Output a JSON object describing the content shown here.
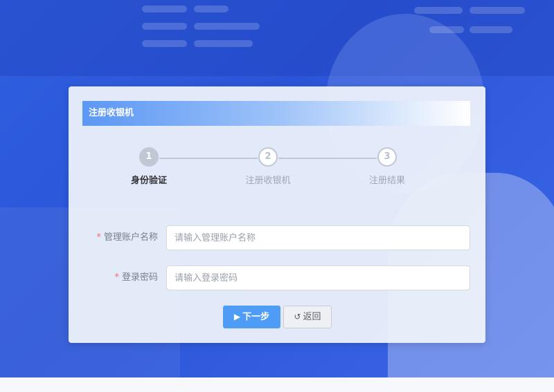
{
  "dialog": {
    "title": "注册收银机"
  },
  "steps": [
    {
      "number": "1",
      "label": "身份验证",
      "state": "active"
    },
    {
      "number": "2",
      "label": "注册收银机",
      "state": "pending"
    },
    {
      "number": "3",
      "label": "注册结果",
      "state": "pending"
    }
  ],
  "form": {
    "required_mark": "*",
    "account": {
      "label": "管理账户名称",
      "placeholder": "请输入管理账户名称",
      "value": ""
    },
    "password": {
      "label": "登录密码",
      "placeholder": "请输入登录密码",
      "value": ""
    }
  },
  "buttons": {
    "next_icon": "play-icon",
    "next_label": "下一步",
    "back_icon": "refresh-icon",
    "back_label": "返回"
  },
  "colors": {
    "background_blue": "#2f5fe0",
    "header_start": "#5b97f4",
    "primary_button": "#4e9cf6",
    "required_red": "#f56c6c"
  }
}
